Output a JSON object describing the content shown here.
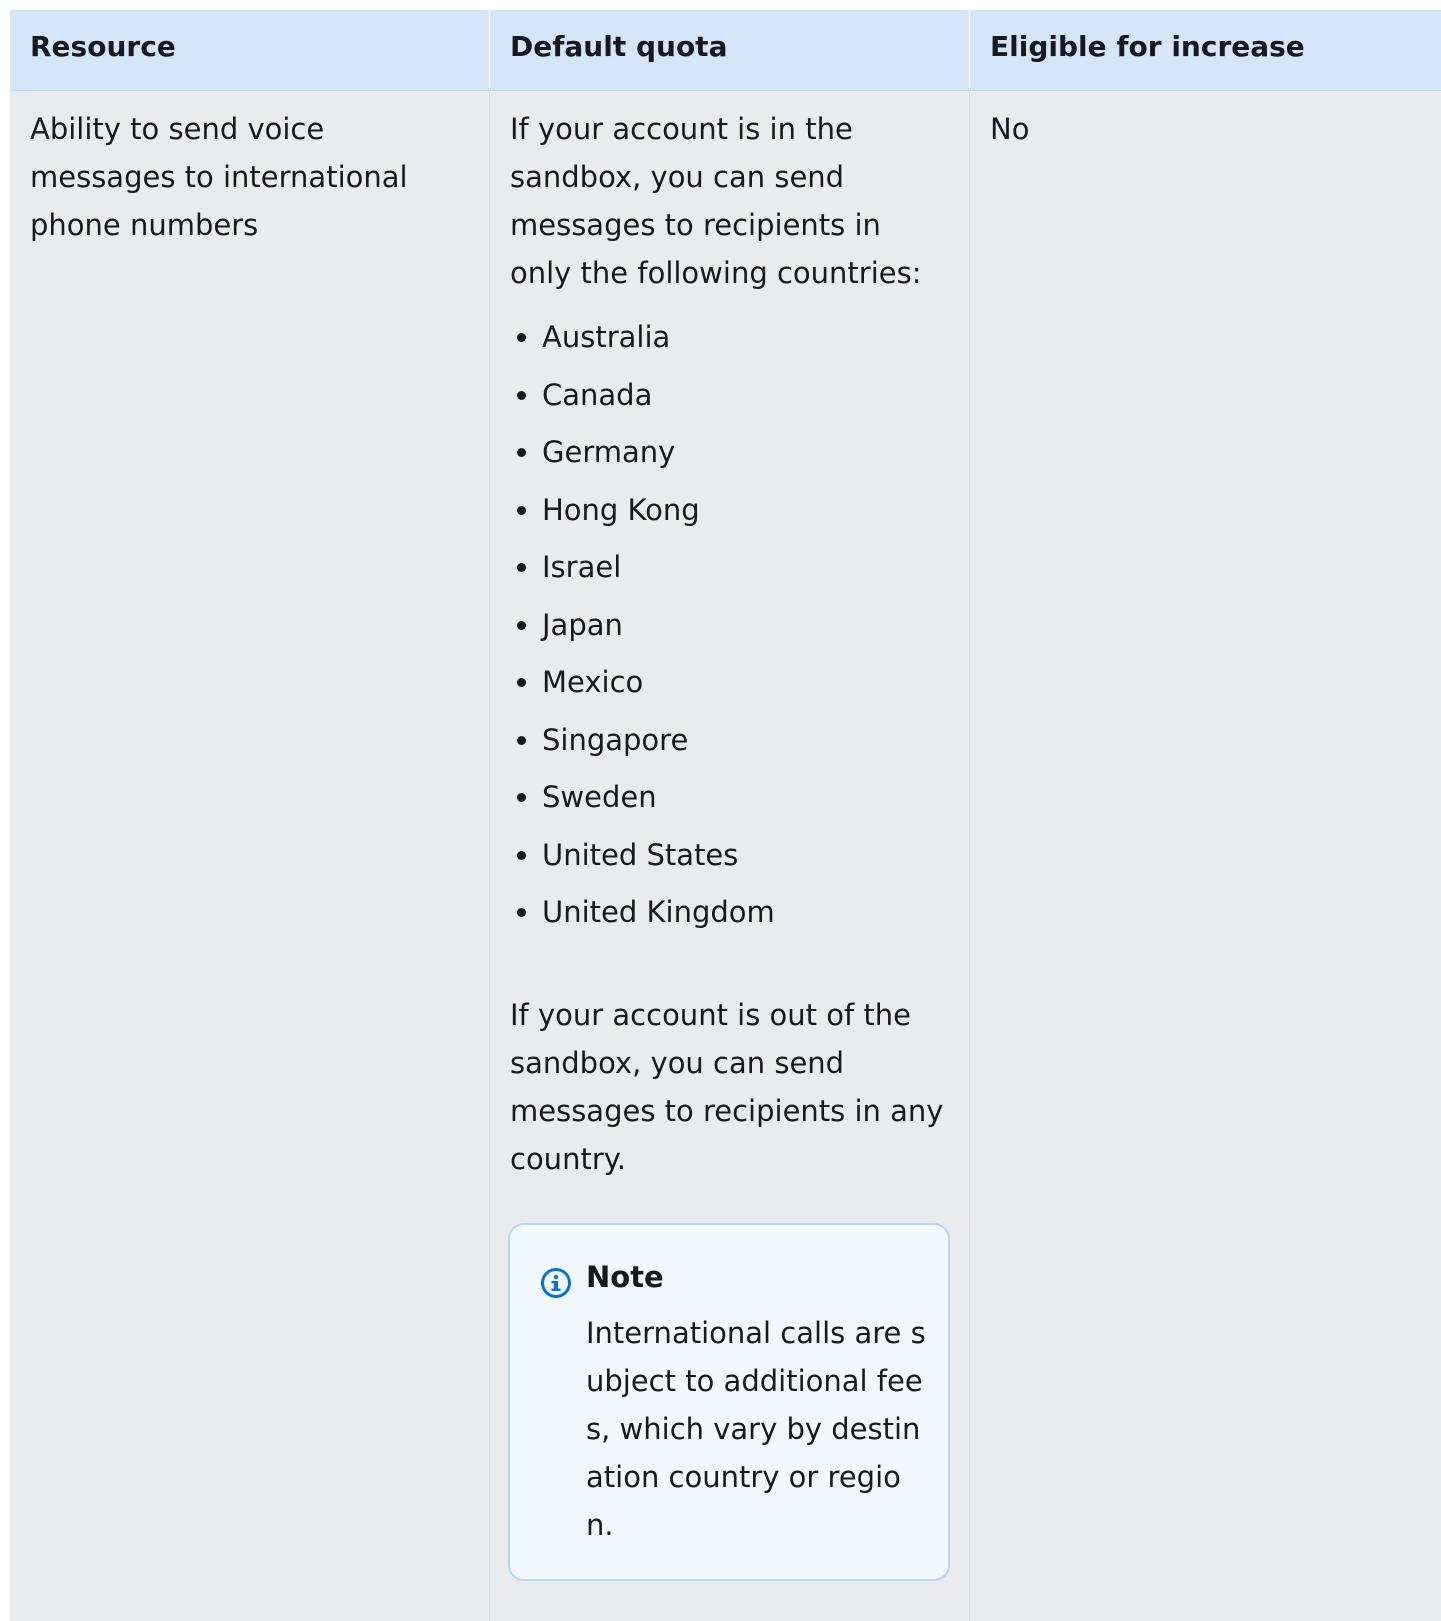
{
  "table": {
    "headers": [
      "Resource",
      "Default quota",
      "Eligible for increase"
    ],
    "row": {
      "resource": "Ability to send voice messages to international phone numbers",
      "quota_intro": "If your account is in the sandbox, you can send messages to recipients in only the following countries:",
      "countries": [
        "Australia",
        "Canada",
        "Germany",
        "Hong Kong",
        "Israel",
        "Japan",
        "Mexico",
        "Singapore",
        "Sweden",
        "United States",
        "United Kingdom"
      ],
      "quota_outro": "If your account is out of the sandbox, you can send messages to recipients in any country.",
      "eligible": "No"
    },
    "note": {
      "icon": "info-icon",
      "title": "Note",
      "text": "International calls are subject to additional fees, which vary by destination country or region."
    }
  },
  "colors": {
    "header_bg": "#d4e6f7",
    "cell_bg": "#eaebed",
    "note_bg": "#f1f8fe",
    "note_border": "#b9d6f1",
    "info_icon": "#0972d3"
  }
}
